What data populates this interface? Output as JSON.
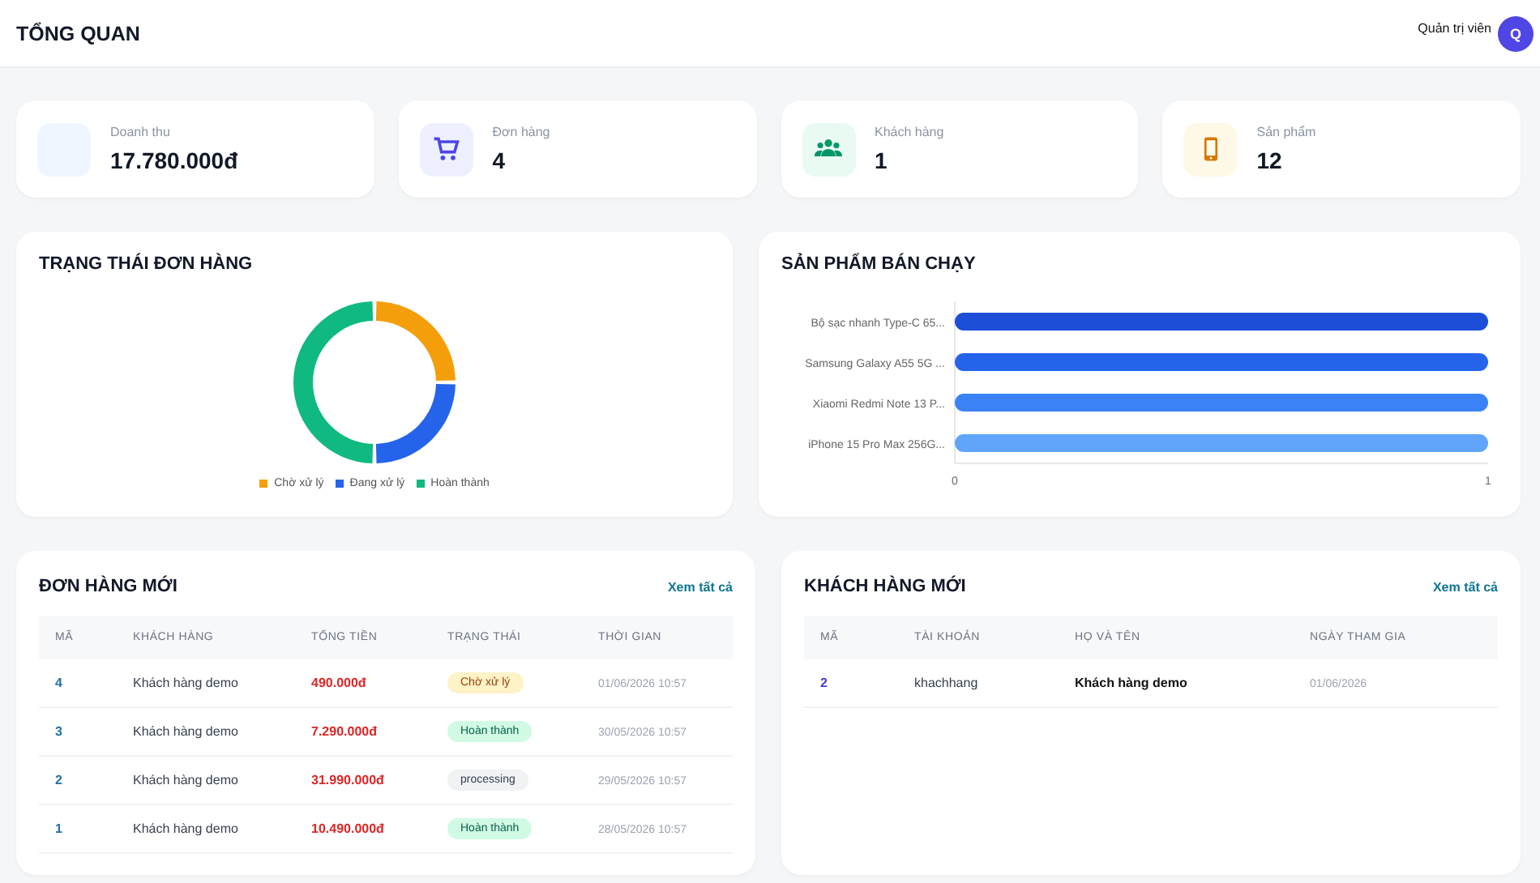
{
  "header": {
    "title": "TỔNG QUAN",
    "user_role": "Quản trị viên",
    "avatar": "Q"
  },
  "stats": [
    {
      "kind": "revenue",
      "label": "Doanh thu",
      "value": "17.780.000đ"
    },
    {
      "kind": "orders",
      "label": "Đơn hàng",
      "value": "4"
    },
    {
      "kind": "customers",
      "label": "Khách hàng",
      "value": "1"
    },
    {
      "kind": "products",
      "label": "Sản phẩm",
      "value": "12"
    }
  ],
  "order_status": {
    "title": "TRẠNG THÁI ĐƠN HÀNG",
    "chart_data": {
      "type": "donut",
      "categories": [
        "Chờ xử lý",
        "Đang xử lý",
        "Hoàn thành"
      ],
      "values": [
        25,
        25,
        50
      ],
      "colors": [
        "#f59e0b",
        "#2563eb",
        "#10b981"
      ],
      "legend": "bottom"
    }
  },
  "best_sellers": {
    "title": "SẢN PHẨM BÁN CHẠY",
    "chart_data": {
      "type": "bar",
      "orientation": "horizontal",
      "categories": [
        "Bộ sạc nhanh Type-C 65...",
        "Samsung Galaxy A55 5G ...",
        "Xiaomi Redmi Note 13 P...",
        "iPhone 15 Pro Max 256G..."
      ],
      "values": [
        1,
        1,
        1,
        1
      ],
      "colors": [
        "#1d4ed8",
        "#2563eb",
        "#3b82f6",
        "#60a5fa"
      ],
      "xlim": [
        0,
        1
      ],
      "xticks": [
        {
          "value": 0,
          "label": "0"
        },
        {
          "value": 1,
          "label": "1"
        }
      ]
    }
  },
  "recent_orders": {
    "title": "ĐƠN HÀNG MỚI",
    "link": "Xem tất cả",
    "columns": [
      "MÃ",
      "KHÁCH HÀNG",
      "TỔNG TIỀN",
      "TRẠNG THÁI",
      "THỜI GIAN"
    ],
    "rows": [
      {
        "id": "4",
        "customer": "Khách hàng demo",
        "total": "490.000đ",
        "status": "Chờ xử lý",
        "kind": "pending",
        "time": "01/06/2026 10:57"
      },
      {
        "id": "3",
        "customer": "Khách hàng demo",
        "total": "7.290.000đ",
        "status": "Hoàn thành",
        "kind": "done",
        "time": "30/05/2026 10:57"
      },
      {
        "id": "2",
        "customer": "Khách hàng demo",
        "total": "31.990.000đ",
        "status": "processing",
        "kind": "other",
        "time": "29/05/2026 10:57"
      },
      {
        "id": "1",
        "customer": "Khách hàng demo",
        "total": "10.490.000đ",
        "status": "Hoàn thành",
        "kind": "done",
        "time": "28/05/2026 10:57"
      }
    ]
  },
  "recent_customers": {
    "title": "KHÁCH HÀNG MỚI",
    "link": "Xem tất cả",
    "columns": [
      "MÃ",
      "TÀI KHOẢN",
      "HỌ VÀ TÊN",
      "NGÀY THAM GIA"
    ],
    "rows": [
      {
        "id": "2",
        "username": "khachhang",
        "full_name": "Khách hàng demo",
        "joined": "01/06/2026"
      }
    ]
  }
}
